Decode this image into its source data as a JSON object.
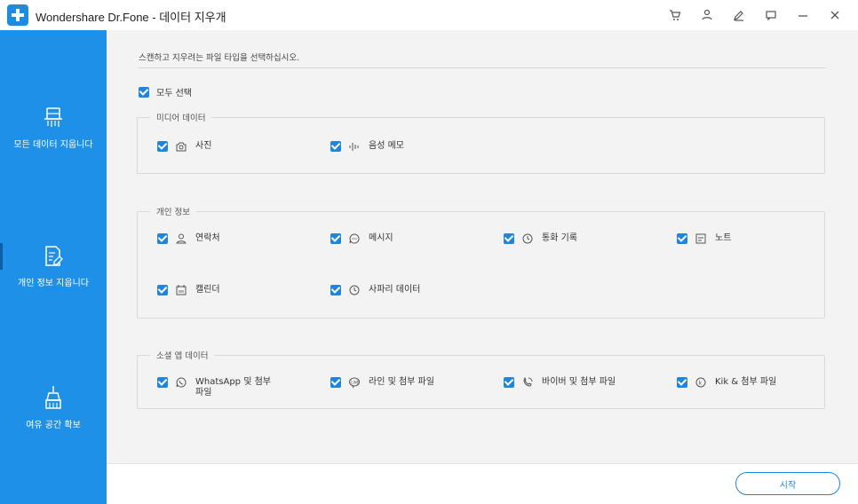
{
  "window": {
    "title": "Wondershare Dr.Fone - 데이터 지우개"
  },
  "sidebar": {
    "items": [
      {
        "label": "모든 데이터 지웁니다",
        "icon": "shredder-icon"
      },
      {
        "label": "개인 정보 지웁니다",
        "icon": "document-erase-icon"
      },
      {
        "label": "여유 공간 확보",
        "icon": "broom-icon"
      }
    ]
  },
  "main": {
    "instruction": "스캔하고 지우려는 파일 타입을 선택하십시오.",
    "select_all": {
      "label": "모두 선택",
      "checked": true
    },
    "groups": [
      {
        "title": "미디어 데이터",
        "items": [
          {
            "label": "사진",
            "icon": "photo-icon",
            "checked": true
          },
          {
            "label": "음성 메모",
            "icon": "voice-memo-icon",
            "checked": true
          }
        ]
      },
      {
        "title": "개인 정보",
        "items": [
          {
            "label": "연락처",
            "icon": "contacts-icon",
            "checked": true
          },
          {
            "label": "메시지",
            "icon": "message-icon",
            "checked": true
          },
          {
            "label": "통화 기록",
            "icon": "call-history-icon",
            "checked": true
          },
          {
            "label": "노트",
            "icon": "notes-icon",
            "checked": true
          },
          {
            "label": "캘린더",
            "icon": "calendar-icon",
            "checked": true
          },
          {
            "label": "사파리 데이터",
            "icon": "safari-icon",
            "checked": true
          }
        ]
      },
      {
        "title": "소셜 앱 데이터",
        "items": [
          {
            "label_line1": "WhatsApp 및 첨부",
            "label_line2": "파일",
            "icon": "whatsapp-icon",
            "checked": true
          },
          {
            "label": "라인 및 첨부 파일",
            "icon": "line-icon",
            "checked": true
          },
          {
            "label": "바이버 및 첨부 파일",
            "icon": "viber-icon",
            "checked": true
          },
          {
            "label": "Kik & 첨부 파일",
            "icon": "kik-icon",
            "checked": true
          }
        ]
      }
    ]
  },
  "footer": {
    "start_label": "시작"
  },
  "colors": {
    "accent": "#1f86dc",
    "sidebar": "#1e90e8",
    "content_bg": "#f3f3f3"
  }
}
